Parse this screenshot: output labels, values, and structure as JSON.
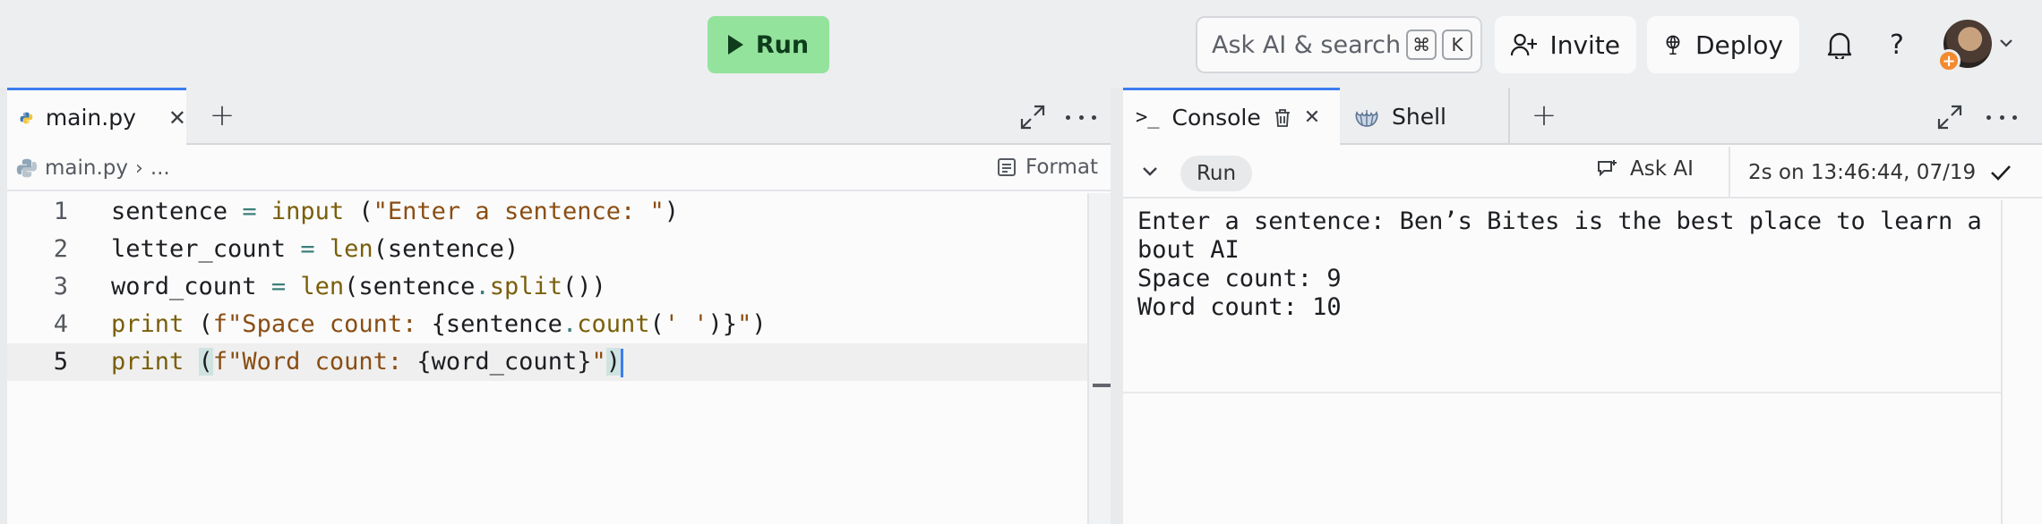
{
  "topbar": {
    "run_label": "Run",
    "search_placeholder": "Ask AI & search",
    "search_shortcut": [
      "⌘",
      "K"
    ],
    "invite_label": "Invite",
    "deploy_label": "Deploy"
  },
  "editor": {
    "tab_label": "main.py",
    "breadcrumb_file": "main.py",
    "breadcrumb_more": "...",
    "format_label": "Format",
    "lines": [
      {
        "n": "1"
      },
      {
        "n": "2"
      },
      {
        "n": "3"
      },
      {
        "n": "4"
      },
      {
        "n": "5"
      }
    ]
  },
  "console": {
    "tab_console": "Console",
    "tab_shell": "Shell",
    "run_label": "Run",
    "ask_ai_label": "Ask AI",
    "timestamp": "2s on 13:46:44, 07/19",
    "output": "Enter a sentence: Ben’s Bites is the best place to learn a\nbout AI\nSpace count: 9\nWord count: 10"
  },
  "colors": {
    "accent": "#3c7df0",
    "run_button": "#94e39d"
  },
  "icons": [
    "play-icon",
    "command-key-icon",
    "add-user-icon",
    "deploy-icon",
    "bell-icon",
    "help-icon",
    "python-icon",
    "close-icon",
    "plus-icon",
    "expand-icon",
    "more-icon",
    "format-icon",
    "terminal-icon",
    "trash-icon",
    "shell-icon",
    "chevron-down-icon",
    "ask-ai-icon",
    "checkmark-icon"
  ]
}
